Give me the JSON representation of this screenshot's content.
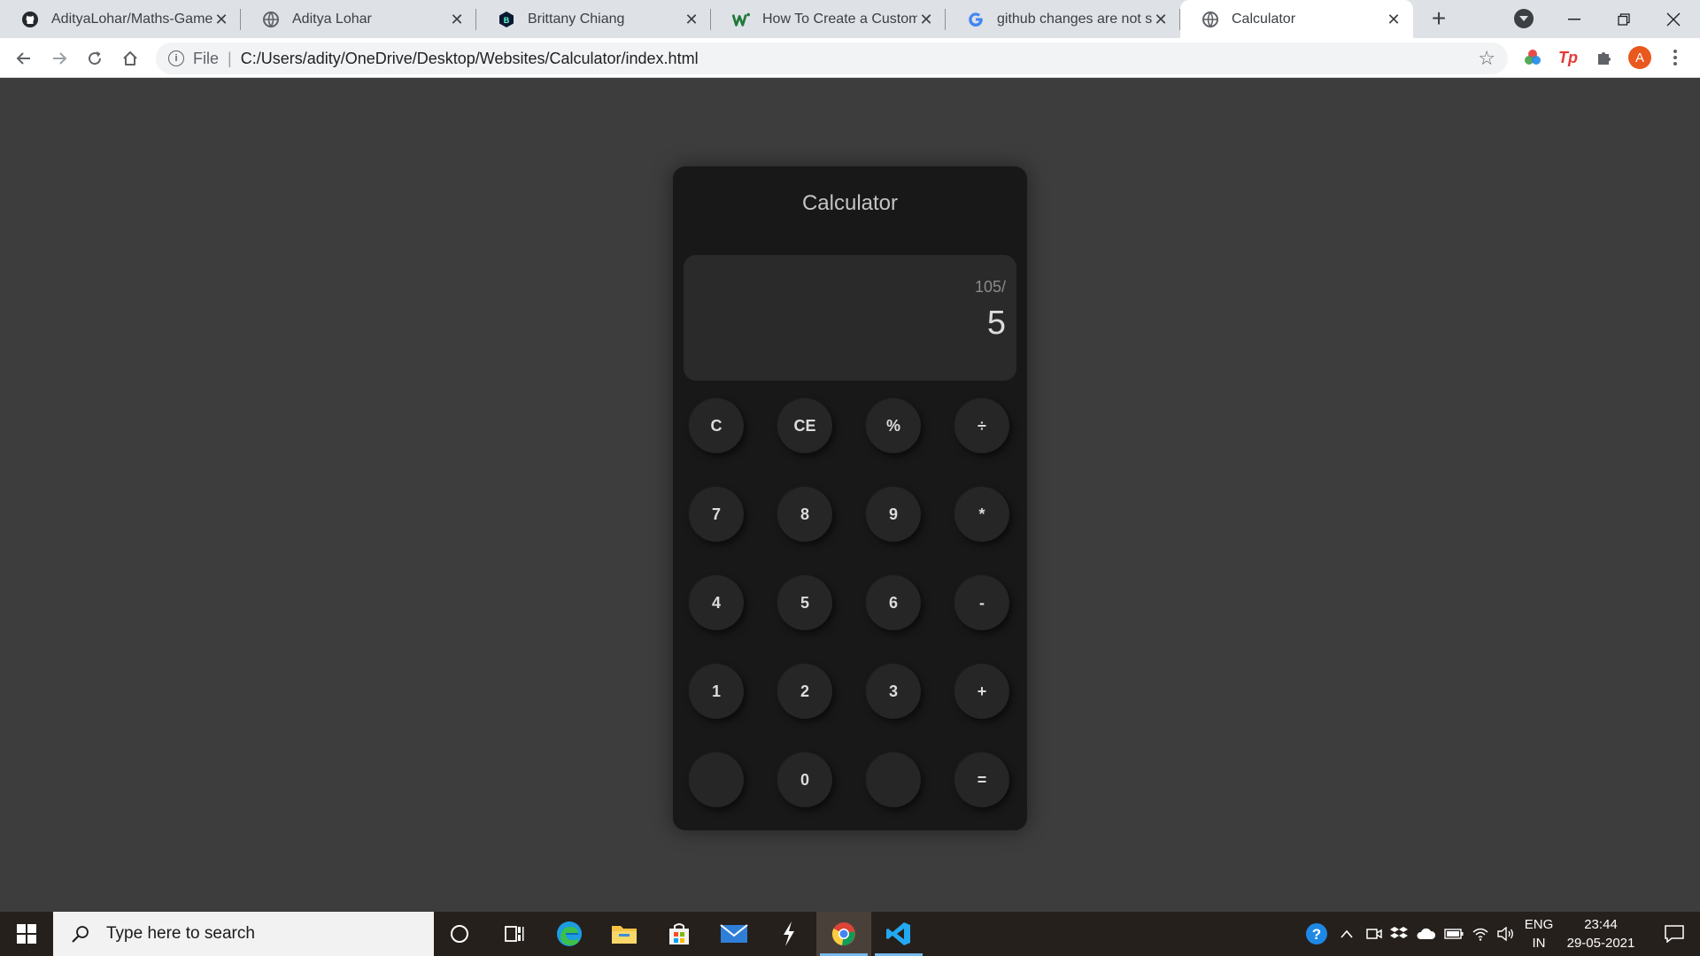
{
  "browser": {
    "tabs": [
      {
        "title": "AdityaLohar/Maths-Game.git",
        "icon": "github-icon",
        "active": false
      },
      {
        "title": "Aditya Lohar",
        "icon": "globe-icon",
        "active": false
      },
      {
        "title": "Brittany Chiang",
        "icon": "hexagon-b-icon",
        "active": false
      },
      {
        "title": "How To Create a Custom Scrollbar",
        "icon": "w-brand-icon",
        "active": false
      },
      {
        "title": "github changes are not seen",
        "icon": "google-g-icon",
        "active": false
      },
      {
        "title": "Calculator",
        "icon": "globe-icon",
        "active": true
      }
    ],
    "address": {
      "scheme_label": "File",
      "path": "C:/Users/adity/OneDrive/Desktop/Websites/Calculator/index.html"
    },
    "profile_initial": "A",
    "extension_tp_label": "Tp"
  },
  "calculator": {
    "title": "Calculator",
    "expression": "105/",
    "current": "5",
    "keys": [
      [
        "C",
        "CE",
        "%",
        "÷"
      ],
      [
        "7",
        "8",
        "9",
        "*"
      ],
      [
        "4",
        "5",
        "6",
        "-"
      ],
      [
        "1",
        "2",
        "3",
        "+"
      ],
      [
        "",
        "0",
        "",
        "="
      ]
    ]
  },
  "taskbar": {
    "search_placeholder": "Type here to search",
    "language": "ENG",
    "region": "IN",
    "time": "23:44",
    "date": "29-05-2021"
  },
  "colors": {
    "page_bg": "#3d3d3d",
    "calc_bg": "#181818",
    "display_bg": "#2a2a2a",
    "key_bg": "#262626",
    "taskbar_bg": "#26201c"
  }
}
